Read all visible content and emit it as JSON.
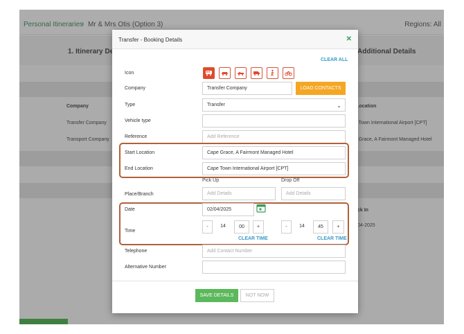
{
  "breadcrumb": {
    "parent": "Personal Itineraries",
    "separator": "›",
    "current": "Mr & Mrs Otis (Option 3)",
    "regions": "Regions: All"
  },
  "steps": {
    "step1": "1. Itinerary Det",
    "step3": "Additional Details"
  },
  "background_table": {
    "company_header": "Company",
    "end_header": "d Location",
    "rows": [
      {
        "company": "Transfer Company",
        "end": "pe Town International Airport [CPT]"
      },
      {
        "company": "Transport Company",
        "end": "pe Grace, A Fairmont Managed Hotel"
      }
    ],
    "pickup_header": "ck In",
    "pickup_value": "04-2025"
  },
  "modal": {
    "title": "Transfer - Booking Details",
    "clear_all": "CLEAR ALL",
    "labels": {
      "icon": "Icon",
      "company": "Company",
      "type": "Type",
      "vehicle_type": "Vehicle type",
      "reference": "Reference",
      "start_location": "Start Location",
      "end_location": "End Location",
      "place_branch": "Place/Branch",
      "date": "Date",
      "time": "Time",
      "telephone": "Telephone",
      "alternative_number": "Alternative Number"
    },
    "icons": [
      "bus-icon",
      "car-icon",
      "convertible-icon",
      "van-icon",
      "walking-icon",
      "bicycle-icon"
    ],
    "company_value": "Transfer Company",
    "load_contacts": "LOAD CONTACTS",
    "type_value": "Transfer",
    "vehicle_type_value": "",
    "reference_placeholder": "Add Reference",
    "start_location_value": "Cape Grace, A Fairmont Managed Hotel",
    "end_location_value": "Cape Town International Airport [CPT]",
    "pickup_label": "Pick Up",
    "dropoff_label": "Drop Off",
    "pickup_placeholder": "Add Details",
    "dropoff_placeholder": "Add Details",
    "date_value": "02/04/2025",
    "time_pickup": {
      "minus": "-",
      "hour": "14",
      "minute": "00",
      "plus": "+"
    },
    "time_dropoff": {
      "minus": "-",
      "hour": "14",
      "minute": "45",
      "plus": "+"
    },
    "clear_time": "CLEAR TIME",
    "telephone_placeholder": "Add Contact Number",
    "alternative_value": "",
    "save_details": "SAVE DETAILS",
    "not_now": "NOT NOW"
  },
  "colors": {
    "accent_orange": "#f5a623",
    "icon_red": "#e14a2a",
    "save_green": "#5cb85c",
    "link_blue": "#3a9ac8",
    "highlight": "#b0603a"
  }
}
